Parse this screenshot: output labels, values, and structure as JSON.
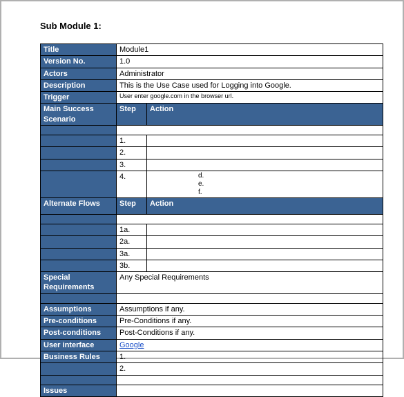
{
  "heading": "Sub Module 1:",
  "labels": {
    "title": "Title",
    "version": "Version No.",
    "actors": "Actors",
    "description": "Description",
    "trigger": "Trigger",
    "main_scenario": "Main Success Scenario",
    "step": "Step",
    "action": "Action",
    "alt_flows": "Alternate Flows",
    "special_req": "Special Requirements",
    "assumptions": "Assumptions",
    "pre_cond": "Pre-conditions",
    "post_cond": "Post-conditions",
    "ui": "User interface",
    "biz_rules": "Business Rules",
    "issues": "Issues"
  },
  "values": {
    "title": "Module1",
    "version": "1.0",
    "actors": "Administrator",
    "description": "This is the Use Case used for Logging into Google.",
    "trigger": "User enter google.com in the browser url.",
    "special_req": "Any Special Requirements",
    "assumptions": "Assumptions if any.",
    "pre_cond": "Pre-Conditions if any.",
    "post_cond": "Post-Conditions if any.",
    "ui_link": "Google"
  },
  "main_steps": [
    "1.",
    "2.",
    "3.",
    "4."
  ],
  "main_sub": [
    "d.",
    "e.",
    "f."
  ],
  "alt_steps": [
    "1a.",
    "2a.",
    "3a.",
    "3b."
  ],
  "biz_steps": [
    "1.",
    "2."
  ]
}
